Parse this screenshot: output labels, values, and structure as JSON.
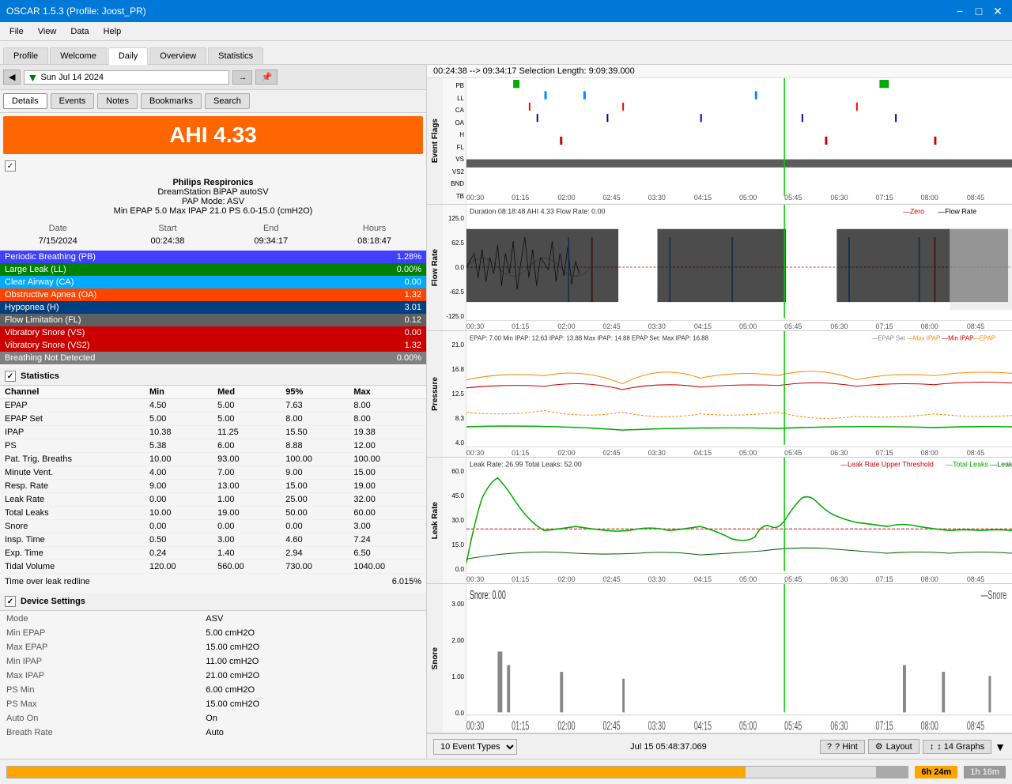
{
  "window": {
    "title": "OSCAR 1.5.3 (Profile: Joost_PR)",
    "min_btn": "−",
    "max_btn": "□",
    "close_btn": "✕"
  },
  "menu": {
    "items": [
      "File",
      "View",
      "Data",
      "Help"
    ]
  },
  "tabs": {
    "items": [
      "Profile",
      "Welcome",
      "Daily",
      "Overview",
      "Statistics"
    ],
    "active": "Daily"
  },
  "nav": {
    "back_btn": "◀",
    "forward_btn": "▶",
    "jump_btn": "⊞",
    "date": "Sun Jul 14 2024",
    "arrow_right": "→",
    "pin_btn": "📌"
  },
  "sub_tabs": {
    "items": [
      "Details",
      "Events",
      "Notes",
      "Bookmarks",
      "Search"
    ],
    "active": "Details"
  },
  "ahi": {
    "value": "AHI 4.33"
  },
  "device": {
    "name": "Philips Respironics",
    "model": "DreamStation BiPAP autoSV",
    "pap_mode": "PAP Mode: ASV",
    "pressure": "Min EPAP 5.0 Max IPAP 21.0 PS 6.0-15.0 (cmH2O)"
  },
  "date_time": {
    "headers": [
      "Date",
      "Start",
      "End",
      "Hours"
    ],
    "values": [
      "7/15/2024",
      "00:24:38",
      "09:34:17",
      "08:18:47"
    ]
  },
  "events": [
    {
      "name": "Periodic Breathing (PB)",
      "value": "1.28%",
      "class": "pb"
    },
    {
      "name": "Large Leak (LL)",
      "value": "0.00%",
      "class": "ll"
    },
    {
      "name": "Clear Airway (CA)",
      "value": "0.00",
      "class": "ca"
    },
    {
      "name": "Obstructive Apnea (OA)",
      "value": "1.32",
      "class": "oa"
    },
    {
      "name": "Hypopnea (H)",
      "value": "3.01",
      "class": "h"
    },
    {
      "name": "Flow Limitation (FL)",
      "value": "0.12",
      "class": "fl"
    },
    {
      "name": "Vibratory Snore (VS)",
      "value": "0.00",
      "class": "vs"
    },
    {
      "name": "Vibratory Snore (VS2)",
      "value": "1.32",
      "class": "vs2"
    },
    {
      "name": "Breathing Not Detected",
      "value": "0.00%",
      "class": "bnd"
    }
  ],
  "statistics": {
    "title": "Statistics",
    "columns": [
      "Channel",
      "Min",
      "Med",
      "95%",
      "Max"
    ],
    "rows": [
      [
        "EPAP",
        "4.50",
        "5.00",
        "7.63",
        "8.00"
      ],
      [
        "EPAP Set",
        "5.00",
        "5.00",
        "8.00",
        "8.00"
      ],
      [
        "IPAP",
        "10.38",
        "11.25",
        "15.50",
        "19.38"
      ],
      [
        "PS",
        "5.38",
        "6.00",
        "8.88",
        "12.00"
      ],
      [
        "Pat. Trig. Breaths",
        "10.00",
        "93.00",
        "100.00",
        "100.00"
      ],
      [
        "Minute Vent.",
        "4.00",
        "7.00",
        "9.00",
        "15.00"
      ],
      [
        "Resp. Rate",
        "9.00",
        "13.00",
        "15.00",
        "19.00"
      ],
      [
        "Leak Rate",
        "0.00",
        "1.00",
        "25.00",
        "32.00"
      ],
      [
        "Total Leaks",
        "10.00",
        "19.00",
        "50.00",
        "60.00"
      ],
      [
        "Snore",
        "0.00",
        "0.00",
        "0.00",
        "3.00"
      ],
      [
        "Insp. Time",
        "0.50",
        "3.00",
        "4.60",
        "7.24"
      ],
      [
        "Exp. Time",
        "0.24",
        "1.40",
        "2.94",
        "6.50"
      ],
      [
        "Tidal Volume",
        "120.00",
        "560.00",
        "730.00",
        "1040.00"
      ]
    ],
    "time_over_leak_label": "Time over leak redline",
    "time_over_leak_value": "6.015%"
  },
  "device_settings": {
    "title": "Device Settings",
    "rows": [
      [
        "Mode",
        "ASV"
      ],
      [
        "Min EPAP",
        "5.00 cmH2O"
      ],
      [
        "Max EPAP",
        "15.00 cmH2O"
      ],
      [
        "Min IPAP",
        "11.00 cmH2O"
      ],
      [
        "Max IPAP",
        "21.00 cmH2O"
      ],
      [
        "PS Min",
        "6.00 cmH2O"
      ],
      [
        "PS Max",
        "15.00 cmH2O"
      ],
      [
        "Auto On",
        "On"
      ],
      [
        "Breath Rate",
        "Auto"
      ]
    ]
  },
  "charts": {
    "header": "00:24:38 --> 09:34:17    Selection Length: 9:09:39.000",
    "event_flags": {
      "title": "Event Flags",
      "labels": [
        "PB",
        "LL",
        "CA",
        "OA",
        "H",
        "FL",
        "VS",
        "VS2",
        "BND",
        "TB"
      ]
    },
    "flow_rate": {
      "title": "Duration 08:18:48 AHI 4.33 Flow Rate: 0.00",
      "legend": [
        "Zero",
        "Flow Rate"
      ],
      "y_label": "Flow Rate",
      "y_max": "125.0",
      "y_mid": "62.5",
      "y_zero": "0.0",
      "y_neg_mid": "-62.5",
      "y_min": "-125.0"
    },
    "pressure": {
      "title": "EPAP: 7.00  Min IPAP: 12.63  IPAP: 13.88  Max IPAP: 14.88  EPAP Set: Max IPAP: 16.88",
      "legend": [
        "EPAP Set",
        "Max IPAP",
        "Min IPAP",
        "EPAP"
      ],
      "y_label": "Pressure",
      "y_max": "21.0",
      "y_mid": "16.8",
      "y_mid2": "12.5",
      "y_mid3": "8.3",
      "y_min": "4.0"
    },
    "leak_rate": {
      "title": "Leak Rate: 26.99  Total Leaks: 52.00",
      "legend": [
        "Leak Rate Upper Threshold",
        "Total Leaks",
        "Leak Rate"
      ],
      "y_label": "Leak Rate",
      "y_max": "60.0",
      "y_mid": "45.0",
      "y_mid2": "30.0",
      "y_mid3": "15.0",
      "y_min": "0.0"
    },
    "snore": {
      "title": "Snore: 0.00",
      "legend": [
        "Snore"
      ],
      "y_label": "Snore",
      "y_max": "3.00",
      "y_mid": "2.00",
      "y_mid2": "1.00",
      "y_min": "0.0"
    },
    "x_labels": [
      "00:30",
      "01:15",
      "02:00",
      "02:45",
      "03:30",
      "04:15",
      "05:00",
      "05:45",
      "06:30",
      "07:15",
      "08:00",
      "08:45"
    ]
  },
  "status_bar": {
    "progress_label": "6h 24m",
    "duration_label": "1h 16m"
  },
  "bottom_toolbar": {
    "event_types_label": "10 Event Types",
    "timestamp": "Jul 15 05:48:37.069",
    "hint_btn": "? Hint",
    "layout_btn": "⚙ Layout",
    "graphs_btn": "↕ 14 Graphs"
  }
}
